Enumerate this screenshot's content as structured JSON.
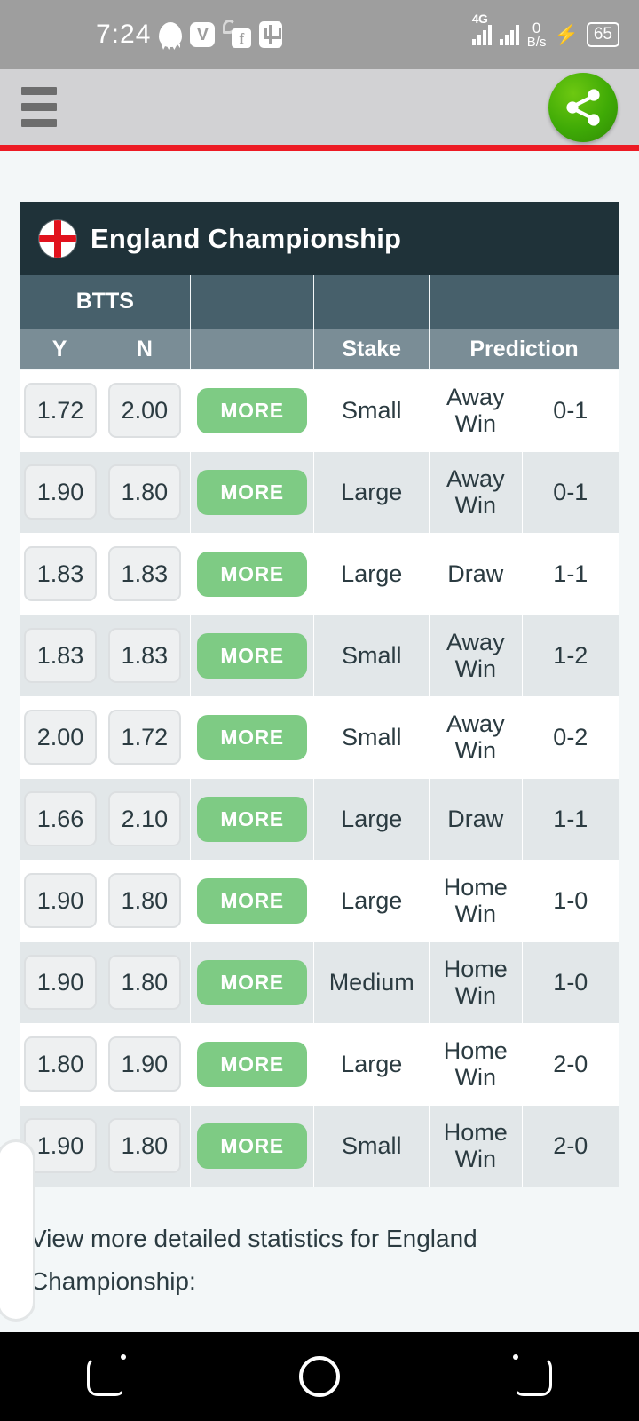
{
  "status_bar": {
    "time": "7:24",
    "left_icons": [
      "snapchat-icon",
      "v-app-icon",
      "uc-facebook-icon",
      "usb-icon"
    ],
    "v_app_letter": "V",
    "facebook_letter": "f",
    "network_type": "4G",
    "data_speed_value": "0",
    "data_speed_unit": "B/s",
    "charging_glyph": "⚡",
    "battery_level": "65"
  },
  "toolbar": {
    "menu_label": "menu",
    "share_label": "share",
    "accent_color": "#ed1b24"
  },
  "league": {
    "name": "England Championship",
    "flag": "england-flag-icon",
    "header_color": "#1f3239"
  },
  "table": {
    "group_headers": [
      "BTTS",
      "",
      "",
      ""
    ],
    "sub_headers": [
      "Y",
      "N",
      "",
      "Stake",
      "Prediction"
    ],
    "more_label": "MORE",
    "group_header_color": "#47606b",
    "sub_header_color": "#7a8d96",
    "more_button_color": "#7ecb84",
    "rows": [
      {
        "btts_y": "1.72",
        "btts_n": "2.00",
        "more": "MORE",
        "stake": "Small",
        "prediction": "Away Win",
        "score": "0-1"
      },
      {
        "btts_y": "1.90",
        "btts_n": "1.80",
        "more": "MORE",
        "stake": "Large",
        "prediction": "Away Win",
        "score": "0-1"
      },
      {
        "btts_y": "1.83",
        "btts_n": "1.83",
        "more": "MORE",
        "stake": "Large",
        "prediction": "Draw",
        "score": "1-1"
      },
      {
        "btts_y": "1.83",
        "btts_n": "1.83",
        "more": "MORE",
        "stake": "Small",
        "prediction": "Away Win",
        "score": "1-2"
      },
      {
        "btts_y": "2.00",
        "btts_n": "1.72",
        "more": "MORE",
        "stake": "Small",
        "prediction": "Away Win",
        "score": "0-2"
      },
      {
        "btts_y": "1.66",
        "btts_n": "2.10",
        "more": "MORE",
        "stake": "Large",
        "prediction": "Draw",
        "score": "1-1"
      },
      {
        "btts_y": "1.90",
        "btts_n": "1.80",
        "more": "MORE",
        "stake": "Large",
        "prediction": "Home Win",
        "score": "1-0"
      },
      {
        "btts_y": "1.90",
        "btts_n": "1.80",
        "more": "MORE",
        "stake": "Medium",
        "prediction": "Home Win",
        "score": "1-0"
      },
      {
        "btts_y": "1.80",
        "btts_n": "1.90",
        "more": "MORE",
        "stake": "Large",
        "prediction": "Home Win",
        "score": "2-0"
      },
      {
        "btts_y": "1.90",
        "btts_n": "1.80",
        "more": "MORE",
        "stake": "Small",
        "prediction": "Home Win",
        "score": "2-0"
      }
    ]
  },
  "scroll_top": {
    "icon": "chevron-up-icon"
  },
  "footnote": {
    "text": "View more detailed statistics for England Championship:"
  },
  "nav_bar": {
    "recents": "recents-icon",
    "home": "home-icon",
    "back": "back-icon"
  }
}
